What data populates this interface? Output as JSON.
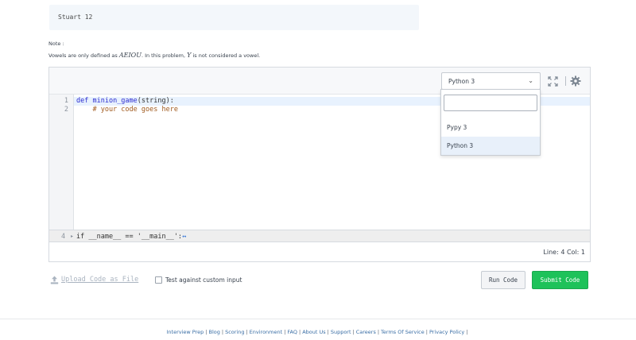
{
  "sample_output": {
    "text": "Stuart 12"
  },
  "note": {
    "label": "Note :",
    "prefix": "Vowels are only defined as ",
    "vowels": "AEIOU",
    "middle": ". In this problem, ",
    "y": "Y",
    "suffix": " is not considered a vowel."
  },
  "editor": {
    "language": "Python 3",
    "lines": [
      {
        "number": "1",
        "keyword": "def ",
        "func": "minion_game",
        "rest": "(string):"
      },
      {
        "number": "2",
        "comment": "    # your code goes here"
      }
    ],
    "folded_line": {
      "number": "4",
      "code": "if __name__ == '__main__':",
      "ellipsis": "↔"
    },
    "status": "Line: 4 Col: 1",
    "icons": {
      "expand": "expand-icon",
      "settings": "gear-icon"
    }
  },
  "language_dropdown": {
    "search_placeholder": "",
    "options": [
      {
        "label": "Pypy 3",
        "selected": false
      },
      {
        "label": "Python 3",
        "selected": true
      }
    ]
  },
  "actions": {
    "upload_label": "Upload Code as File",
    "custom_input_label": "Test against custom input",
    "run_label": "Run Code",
    "submit_label": "Submit Code"
  },
  "footer": {
    "links": [
      "Interview Prep",
      "Blog",
      "Scoring",
      "Environment",
      "FAQ",
      "About Us",
      "Support",
      "Careers",
      "Terms Of Service",
      "Privacy Policy"
    ]
  },
  "colors": {
    "submit": "#1ec25a",
    "link": "#3a6ea5",
    "active_line": "#e8f2fe"
  }
}
